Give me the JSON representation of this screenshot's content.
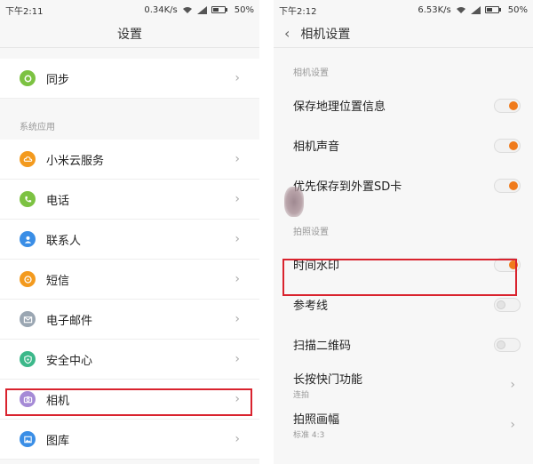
{
  "left_screen": {
    "status": {
      "time": "下午2:11",
      "speed": "0.34K/s",
      "battery": "50%"
    },
    "title": "设置",
    "top_items": [
      {
        "label": "同步",
        "icon": "sync-icon",
        "color": "#7cc242"
      }
    ],
    "section_label": "系统应用",
    "items": [
      {
        "label": "小米云服务",
        "icon": "cloud-icon",
        "color": "#f39a1e"
      },
      {
        "label": "电话",
        "icon": "phone-icon",
        "color": "#7cc242"
      },
      {
        "label": "联系人",
        "icon": "contact-icon",
        "color": "#3a8ee6"
      },
      {
        "label": "短信",
        "icon": "message-icon",
        "color": "#f39a1e"
      },
      {
        "label": "电子邮件",
        "icon": "mail-icon",
        "color": "#9aa6b2"
      },
      {
        "label": "安全中心",
        "icon": "shield-icon",
        "color": "#3cb88a"
      },
      {
        "label": "相机",
        "icon": "camera-icon",
        "color": "#a58ad6"
      },
      {
        "label": "图库",
        "icon": "gallery-icon",
        "color": "#3a8ee6"
      }
    ]
  },
  "right_screen": {
    "status": {
      "time": "下午2:12",
      "speed": "6.53K/s",
      "battery": "50%"
    },
    "title": "相机设置",
    "section1_label": "相机设置",
    "section1": [
      {
        "label": "保存地理位置信息",
        "state": "on"
      },
      {
        "label": "相机声音",
        "state": "on"
      },
      {
        "label": "优先保存到外置SD卡",
        "state": "on"
      }
    ],
    "section2_label": "拍照设置",
    "section2": [
      {
        "label": "时间水印",
        "state": "on"
      },
      {
        "label": "参考线",
        "state": "off"
      },
      {
        "label": "扫描二维码",
        "state": "off"
      }
    ],
    "nav_items": [
      {
        "label": "长按快门功能",
        "sub": "连拍"
      },
      {
        "label": "拍照画幅",
        "sub": "标准 4:3"
      }
    ]
  },
  "colors": {
    "accent": "#f07a1a",
    "highlight": "#d9232e"
  }
}
